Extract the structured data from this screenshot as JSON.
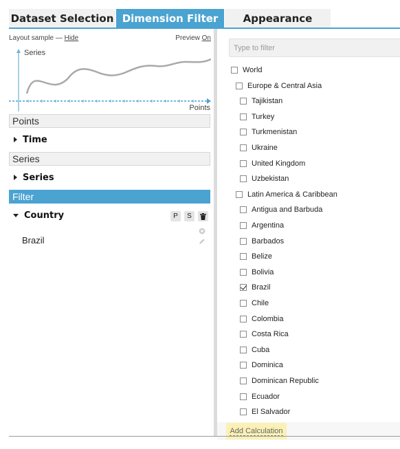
{
  "tabs": [
    {
      "label": "Dataset Selection",
      "active": false
    },
    {
      "label": "Dimension Filter",
      "active": true
    },
    {
      "label": "Appearance",
      "active": false
    }
  ],
  "layout_sample": {
    "label": "Layout sample —",
    "hide_link": "Hide",
    "preview_label": "Preview",
    "preview_link": "On",
    "y_axis_label": "Series",
    "x_axis_label": "Points"
  },
  "sections": {
    "points": {
      "header": "Points",
      "dimension": "Time"
    },
    "series": {
      "header": "Series",
      "dimension": "Series"
    },
    "filter": {
      "header": "Filter",
      "dimension": "Country",
      "buttons": [
        "P",
        "S"
      ],
      "items": [
        "Brazil"
      ]
    }
  },
  "right_panel": {
    "search_placeholder": "Type to filter",
    "tree": [
      {
        "label": "World",
        "level": 0,
        "checked": false
      },
      {
        "label": "Europe & Central Asia",
        "level": 1,
        "checked": false
      },
      {
        "label": "Tajikistan",
        "level": 2,
        "checked": false
      },
      {
        "label": "Turkey",
        "level": 2,
        "checked": false
      },
      {
        "label": "Turkmenistan",
        "level": 2,
        "checked": false
      },
      {
        "label": "Ukraine",
        "level": 2,
        "checked": false
      },
      {
        "label": "United Kingdom",
        "level": 2,
        "checked": false
      },
      {
        "label": "Uzbekistan",
        "level": 2,
        "checked": false
      },
      {
        "label": "Latin America & Caribbean",
        "level": 1,
        "checked": false
      },
      {
        "label": "Antigua and Barbuda",
        "level": 2,
        "checked": false
      },
      {
        "label": "Argentina",
        "level": 2,
        "checked": false
      },
      {
        "label": "Barbados",
        "level": 2,
        "checked": false
      },
      {
        "label": "Belize",
        "level": 2,
        "checked": false
      },
      {
        "label": "Bolivia",
        "level": 2,
        "checked": false
      },
      {
        "label": "Brazil",
        "level": 2,
        "checked": true
      },
      {
        "label": "Chile",
        "level": 2,
        "checked": false
      },
      {
        "label": "Colombia",
        "level": 2,
        "checked": false
      },
      {
        "label": "Costa Rica",
        "level": 2,
        "checked": false
      },
      {
        "label": "Cuba",
        "level": 2,
        "checked": false
      },
      {
        "label": "Dominica",
        "level": 2,
        "checked": false
      },
      {
        "label": "Dominican Republic",
        "level": 2,
        "checked": false
      },
      {
        "label": "Ecuador",
        "level": 2,
        "checked": false
      },
      {
        "label": "El Salvador",
        "level": 2,
        "checked": false
      }
    ],
    "add_calculation": "Add Calculation"
  },
  "colors": {
    "accent": "#4aa3d1",
    "highlight": "#fbf1b6"
  }
}
